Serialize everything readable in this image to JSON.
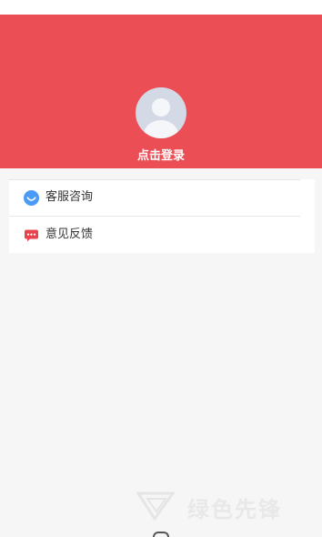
{
  "header": {
    "login_label": "点击登录",
    "bg_color": "#ec4e55"
  },
  "menu": {
    "items": [
      {
        "label": "客服咨询",
        "icon": "customer-service-icon",
        "icon_color": "#4a9bf5"
      },
      {
        "label": "意见反馈",
        "icon": "feedback-icon",
        "icon_color": "#e9444d"
      }
    ]
  },
  "watermark": {
    "text": "绿色先锋"
  }
}
